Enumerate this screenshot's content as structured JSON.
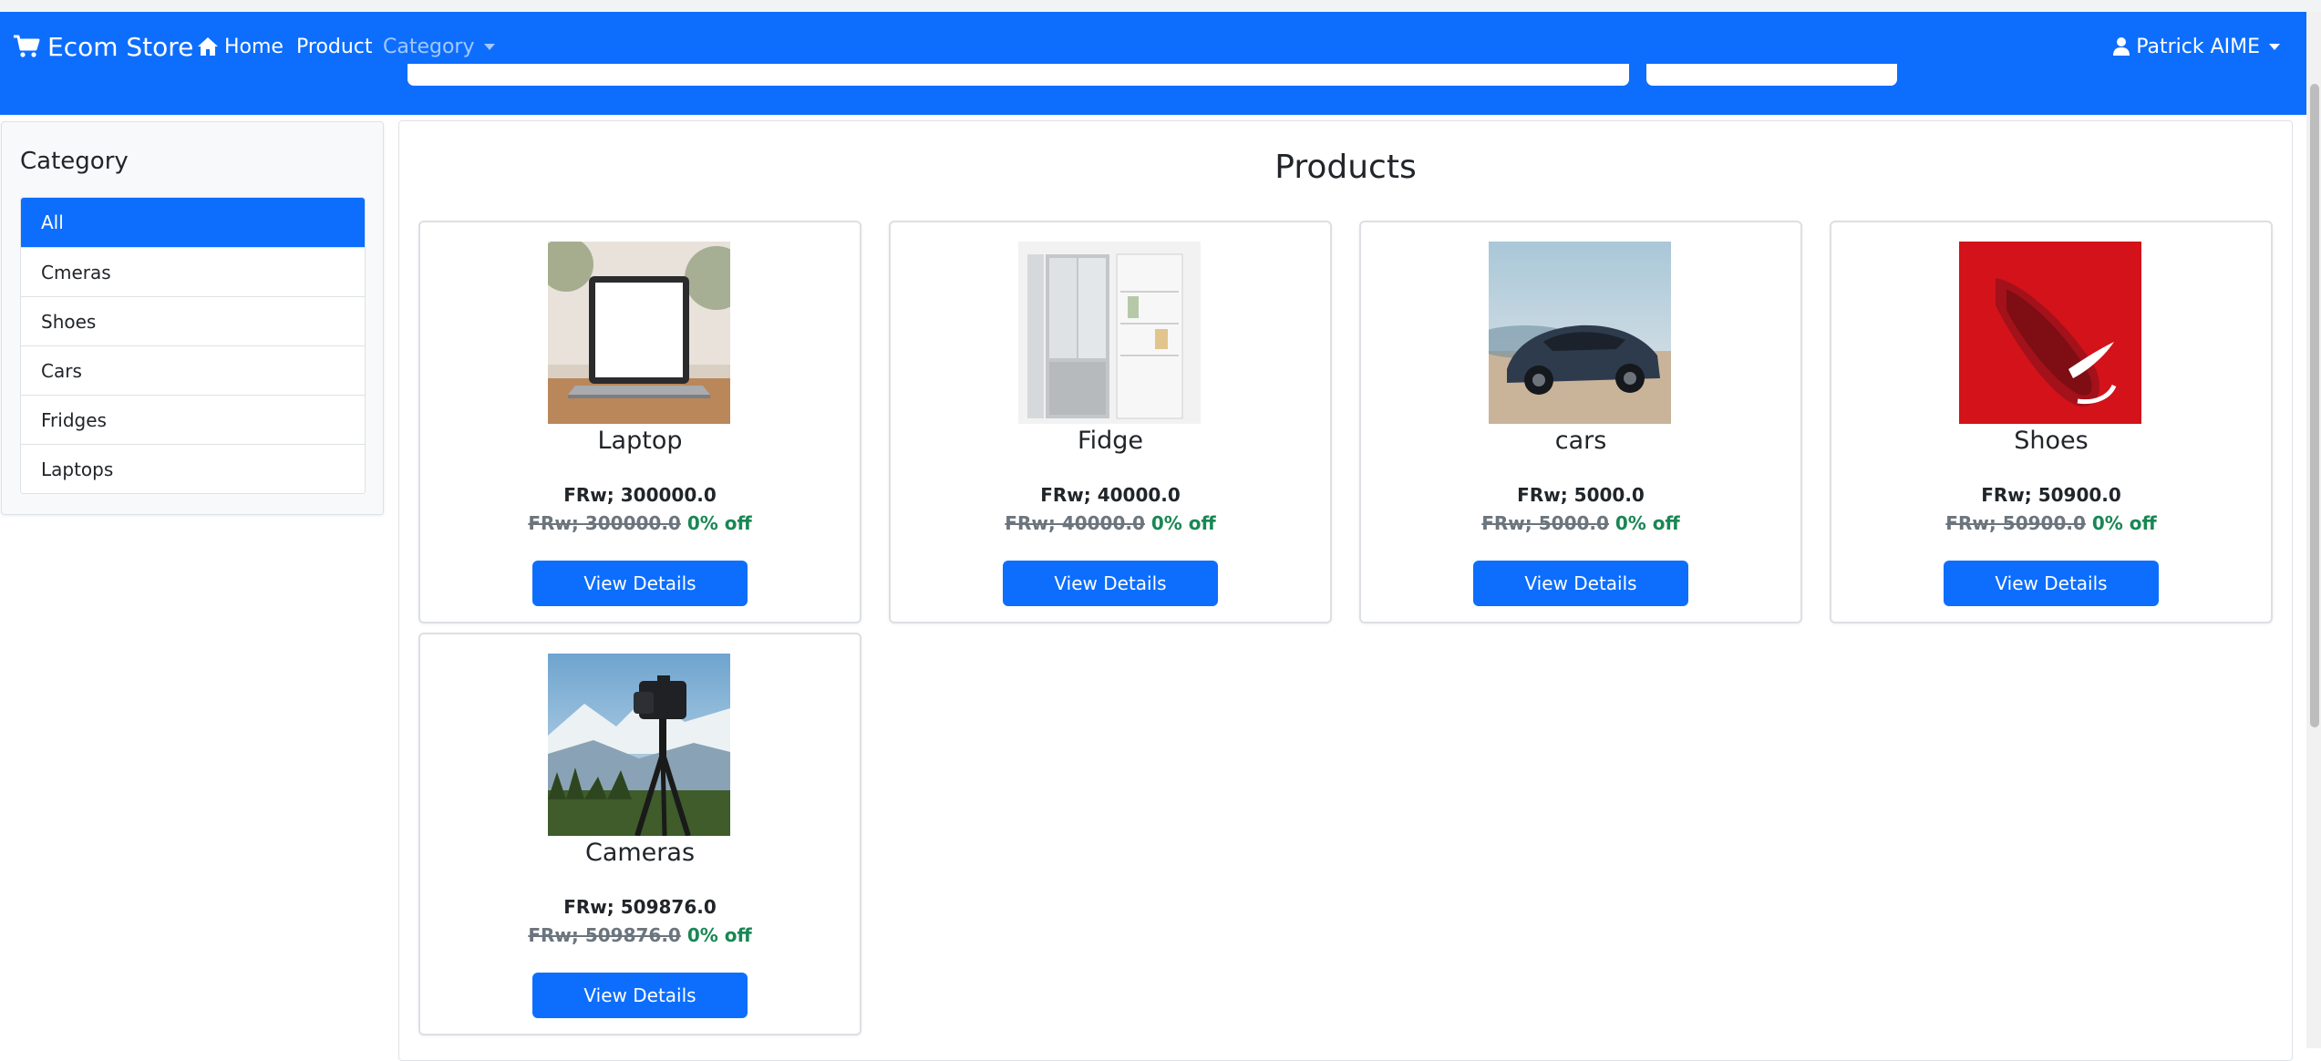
{
  "navbar": {
    "brand": "Ecom Store",
    "home": "Home",
    "product": "Product",
    "category": "Category",
    "user": "Patrick AIME",
    "icons": {
      "cart": "cart-icon",
      "home": "home-icon",
      "user": "user-icon"
    },
    "color": "#0d6efd"
  },
  "sidebar": {
    "title": "Category",
    "items": [
      {
        "label": "All",
        "active": true
      },
      {
        "label": "Cmeras"
      },
      {
        "label": "Shoes"
      },
      {
        "label": "Cars"
      },
      {
        "label": "Fridges"
      },
      {
        "label": "Laptops"
      }
    ]
  },
  "main": {
    "title": "Products",
    "products": [
      {
        "name": "Laptop",
        "price": "FRw; 300000.0",
        "old_price": "FRw; 300000.0",
        "discount": "0% off",
        "button": "View Details",
        "image": "laptop"
      },
      {
        "name": "Fidge",
        "price": "FRw; 40000.0",
        "old_price": "FRw; 40000.0",
        "discount": "0% off",
        "button": "View Details",
        "image": "fridge"
      },
      {
        "name": "cars",
        "price": "FRw; 5000.0",
        "old_price": "FRw; 5000.0",
        "discount": "0% off",
        "button": "View Details",
        "image": "car"
      },
      {
        "name": "Shoes",
        "price": "FRw; 50900.0",
        "old_price": "FRw; 50900.0",
        "discount": "0% off",
        "button": "View Details",
        "image": "shoe"
      },
      {
        "name": "Cameras",
        "price": "FRw; 509876.0",
        "old_price": "FRw; 509876.0",
        "discount": "0% off",
        "button": "View Details",
        "image": "camera"
      }
    ]
  },
  "colors": {
    "primary": "#0d6efd",
    "discount": "#198754",
    "muted": "#6c757d"
  }
}
